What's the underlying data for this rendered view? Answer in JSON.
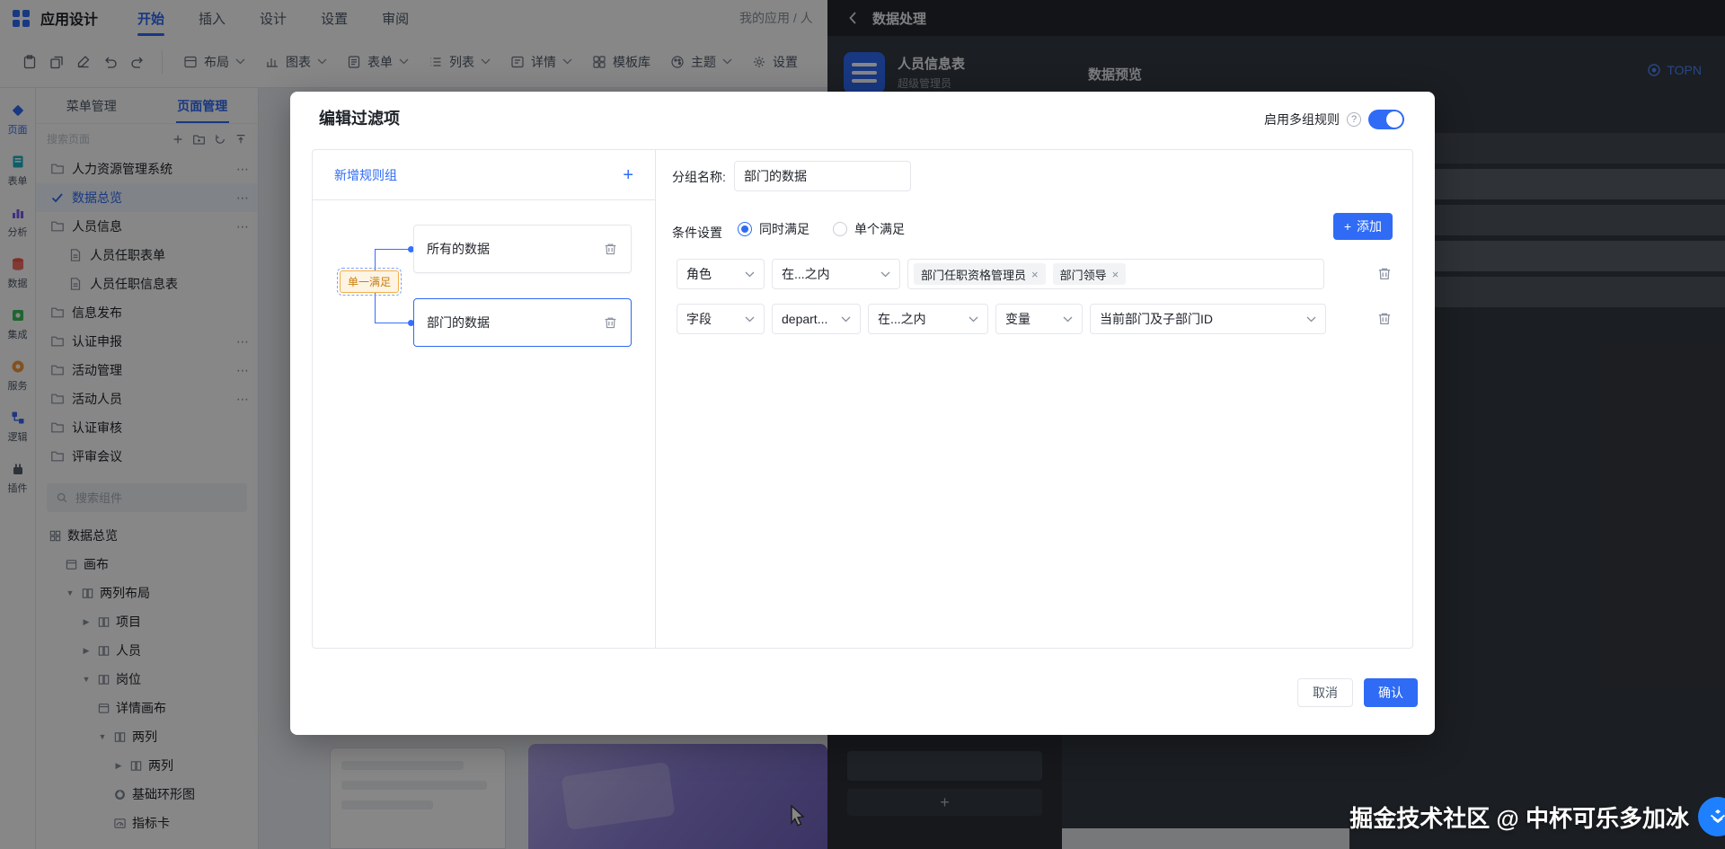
{
  "colors": {
    "accent": "#2f6bf5",
    "badge_border": "#f3b04c",
    "badge_bg": "#fdf4e3"
  },
  "app": {
    "title": "应用设计",
    "menus": [
      "开始",
      "插入",
      "设计",
      "设置",
      "审阅"
    ],
    "breadcrumb": "我的应用 / 人",
    "toolbar_groups": [
      {
        "label": "布局"
      },
      {
        "label": "图表"
      },
      {
        "label": "表单"
      },
      {
        "label": "列表"
      },
      {
        "label": "详情"
      },
      {
        "label": "模板库"
      },
      {
        "label": "主题"
      },
      {
        "label": "设置"
      }
    ]
  },
  "rail": [
    {
      "label": "页面"
    },
    {
      "label": "表单"
    },
    {
      "label": "分析"
    },
    {
      "label": "数据"
    },
    {
      "label": "集成"
    },
    {
      "label": "服务"
    },
    {
      "label": "逻辑"
    },
    {
      "label": "插件"
    }
  ],
  "panel": {
    "tabs": [
      "菜单管理",
      "页面管理"
    ],
    "page_search_placeholder": "搜索页面",
    "tree": [
      {
        "label": "人力资源管理系统"
      },
      {
        "label": "数据总览"
      },
      {
        "label": "人员信息"
      },
      {
        "label": "人员任职表单"
      },
      {
        "label": "人员任职信息表"
      },
      {
        "label": "信息发布"
      },
      {
        "label": "认证申报"
      },
      {
        "label": "活动管理"
      },
      {
        "label": "活动人员"
      },
      {
        "label": "认证审核"
      },
      {
        "label": "评审会议"
      }
    ],
    "component_search_placeholder": "搜索组件",
    "components": [
      {
        "label": "数据总览"
      },
      {
        "label": "画布"
      },
      {
        "label": "两列布局"
      },
      {
        "label": "项目"
      },
      {
        "label": "人员"
      },
      {
        "label": "岗位"
      },
      {
        "label": "详情画布"
      },
      {
        "label": "两列"
      },
      {
        "label": "两列"
      },
      {
        "label": "基础环形图"
      },
      {
        "label": "指标卡"
      }
    ]
  },
  "drawer": {
    "title": "数据处理",
    "source_name": "人员信息表",
    "source_role": "超级管理员",
    "section": "数据预览",
    "topn": "TOPN"
  },
  "modal": {
    "title": "编辑过滤项",
    "multi_rule_label": "启用多组规则",
    "rule_group": {
      "add_label": "新增规则组",
      "nodes": [
        {
          "label": "所有的数据"
        },
        {
          "label": "部门的数据"
        }
      ],
      "badge": "单一满足"
    },
    "form": {
      "group_name_label": "分组名称:",
      "group_name_value": "部门的数据",
      "condition_label": "条件设置",
      "radio_both": "同时满足",
      "radio_single": "单个满足",
      "add_button": "添加",
      "row1": {
        "field": "角色",
        "operator": "在...之内",
        "tags": [
          {
            "label": "部门任职资格管理员"
          },
          {
            "label": "部门领导"
          }
        ]
      },
      "row2": {
        "type": "字段",
        "field": "depart...",
        "operator": "在...之内",
        "value_type": "变量",
        "value": "当前部门及子部门ID"
      }
    },
    "cancel": "取消",
    "confirm": "确认"
  },
  "watermark": "掘金技术社区 @ 中杯可乐多加冰"
}
